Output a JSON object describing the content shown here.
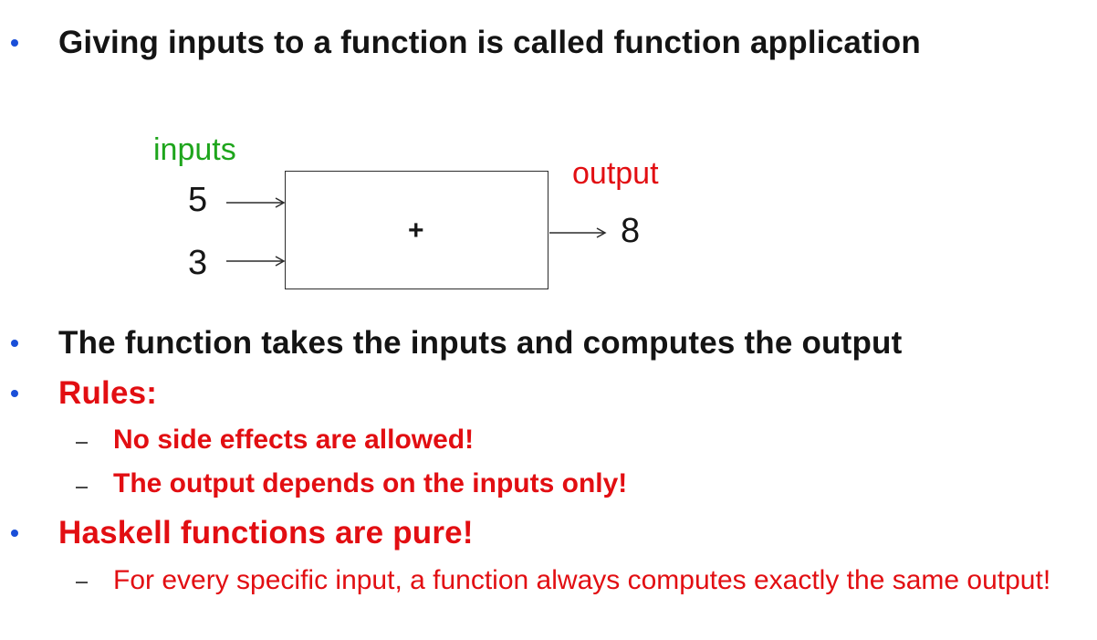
{
  "slide": {
    "bullet1": "Giving inputs to a function is called function application",
    "diagram": {
      "inputs_label": "inputs",
      "output_label": "output",
      "input_a": "5",
      "input_b": "3",
      "operator": "+",
      "result": "8"
    },
    "bullet2": "The function takes the inputs and computes the output",
    "bullet3": "Rules:",
    "rules": [
      "No side effects are allowed!",
      "The output depends on the inputs only!"
    ],
    "bullet4": "Haskell functions are pure!",
    "pure_note": "For every specific input, a function always computes exactly the same output!"
  },
  "colors": {
    "bullet": "#1a4fd8",
    "text": "#141414",
    "red": "#e20e12",
    "green": "#1ea51c"
  }
}
